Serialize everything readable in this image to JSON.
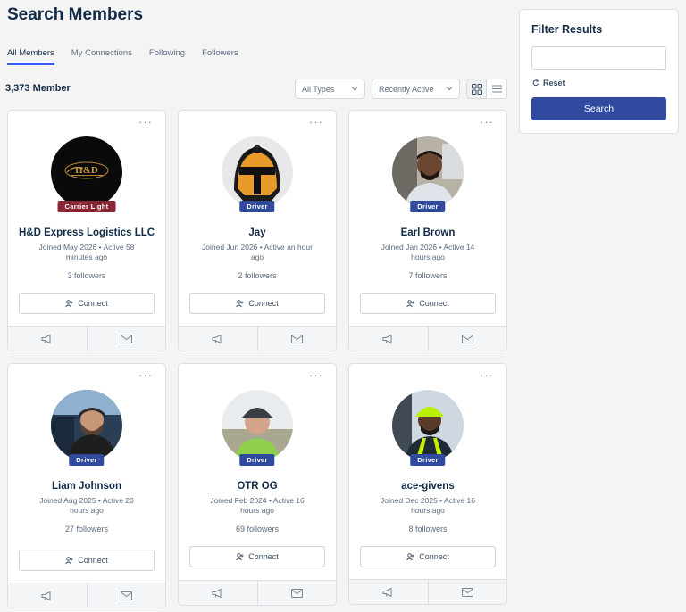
{
  "page": {
    "title": "Search Members"
  },
  "tabs": [
    {
      "label": "All Members",
      "active": true
    },
    {
      "label": "My Connections",
      "active": false
    },
    {
      "label": "Following",
      "active": false
    },
    {
      "label": "Followers",
      "active": false
    }
  ],
  "toolbar": {
    "member_count": "3,373 Member",
    "type_filter": "All Types",
    "sort_filter": "Recently Active"
  },
  "members": [
    {
      "name": "H&D Express Logistics LLC",
      "badge": "Carrier Light",
      "meta": "Joined May 2026 • Active 58 minutes ago",
      "followers": "3 followers",
      "connect": "Connect",
      "avatar_text": "H&D"
    },
    {
      "name": "Jay",
      "badge": "Driver",
      "meta": "Joined Jun 2026 • Active an hour ago",
      "followers": "2 followers",
      "connect": "Connect"
    },
    {
      "name": "Earl Brown",
      "badge": "Driver",
      "meta": "Joined Jan 2026 • Active 14 hours ago",
      "followers": "7 followers",
      "connect": "Connect"
    },
    {
      "name": "Liam Johnson",
      "badge": "Driver",
      "meta": "Joined Aug 2025 • Active 20 hours ago",
      "followers": "27 followers",
      "connect": "Connect"
    },
    {
      "name": "OTR OG",
      "badge": "Driver",
      "meta": "Joined Feb 2024 • Active 16 hours ago",
      "followers": "69 followers",
      "connect": "Connect"
    },
    {
      "name": "ace-givens",
      "badge": "Driver",
      "meta": "Joined Dec 2025 • Active 16 hours ago",
      "followers": "8 followers",
      "connect": "Connect"
    }
  ],
  "filter": {
    "title": "Filter Results",
    "input_value": "",
    "reset_label": "Reset",
    "search_label": "Search"
  },
  "colors": {
    "accent": "#2f4a9e",
    "carrier_badge": "#8b2433",
    "tab_underline": "#385dff"
  }
}
